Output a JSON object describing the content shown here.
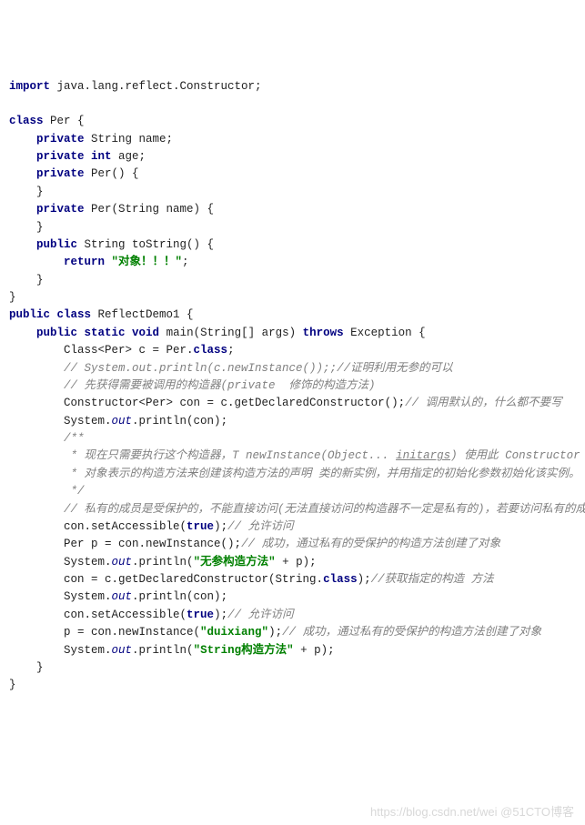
{
  "watermark": "https://blog.csdn.net/wei @51CTO博客",
  "code": {
    "l1": {
      "import": "import",
      "pkg": " java.lang.reflect.Constructor;"
    },
    "l3": {
      "class_kw": "class",
      "cls": " Per {"
    },
    "l4": {
      "priv": "private",
      "ty": " String ",
      "nm": "name;"
    },
    "l5": {
      "priv": "private",
      "ty": " int ",
      "nm": "age;"
    },
    "l6": {
      "priv": "private",
      "sig": " Per() {"
    },
    "l7": {
      "txt": "    }"
    },
    "l8": {
      "priv": "private",
      "sig": " Per(String name) {"
    },
    "l9": {
      "txt": "    }"
    },
    "l10": {
      "pub": "public",
      "ty": " String ",
      "nm": "toString() {"
    },
    "l11": {
      "ret": "return ",
      "str": "\"对象！！！\"",
      "semi": ";"
    },
    "l12": {
      "txt": "    }"
    },
    "l13": {
      "txt": "}"
    },
    "l14": {
      "pub": "public",
      "class_kw": " class",
      "cls": " ReflectDemo1 {"
    },
    "l15": {
      "pub": "public",
      "stat": " static",
      "void": " void",
      "mn": " main(String[] args) ",
      "throws": "throws",
      "ex": " Exception {"
    },
    "l16": {
      "a": "Class<Per> c = Per.",
      "class_kw": "class",
      "b": ";"
    },
    "l17": {
      "cm": "// System.out.println(c.newInstance());;//证明利用无参的可以"
    },
    "l18": {
      "cm": "// 先获得需要被调用的构造器(private  修饰的构造方法)"
    },
    "l19": {
      "a": "Constructor<Per> con = c.getDeclaredConstructor();",
      "cm": "// 调用默认的，什么都不要写"
    },
    "l20": {
      "a": "System.",
      "out": "out",
      "b": ".println(con);"
    },
    "l21": {
      "cm": "/**"
    },
    "l22": {
      "cm": " * 现在只需要执行这个构造器，T newInstance(Object... ",
      "u": "initargs",
      "cm2": ") 使用此 Constructor"
    },
    "l23": {
      "cm": " * 对象表示的构造方法来创建该构造方法的声明 类的新实例，并用指定的初始化参数初始化该实例。"
    },
    "l24": {
      "cm": " */"
    },
    "l25": {
      "cm": "// 私有的成员是受保护的，不能直接访问(无法直接访问的构造器不一定是私有的)，若要访问私有的成员，得先申请一下"
    },
    "l26": {
      "a": "con.setAccessible(",
      "true": "true",
      "b": ");",
      "cm": "// 允许访问"
    },
    "l27": {
      "a": "Per p = con.newInstance();",
      "cm": "// 成功，通过私有的受保护的构造方法创建了对象"
    },
    "l28": {
      "a": "System.",
      "out": "out",
      "b": ".println(",
      "str": "\"无参构造方法\"",
      "c": " + p);"
    },
    "l29": {
      "a": "con = c.getDeclaredConstructor(String.",
      "class_kw": "class",
      "b": ");",
      "cm": "//获取指定的构造 方法"
    },
    "l30": {
      "a": "System.",
      "out": "out",
      "b": ".println(con);"
    },
    "l31": {
      "a": "con.setAccessible(",
      "true": "true",
      "b": ");",
      "cm": "// 允许访问"
    },
    "l32": {
      "a": "p = con.newInstance(",
      "str": "\"duixiang\"",
      "b": ");",
      "cm": "// 成功，通过私有的受保护的构造方法创建了对象"
    },
    "l33": {
      "a": "System.",
      "out": "out",
      "b": ".println(",
      "str": "\"String构造方法\"",
      "c": " + p);"
    },
    "l34": {
      "txt": "    }"
    },
    "l35": {
      "txt": "}"
    }
  }
}
